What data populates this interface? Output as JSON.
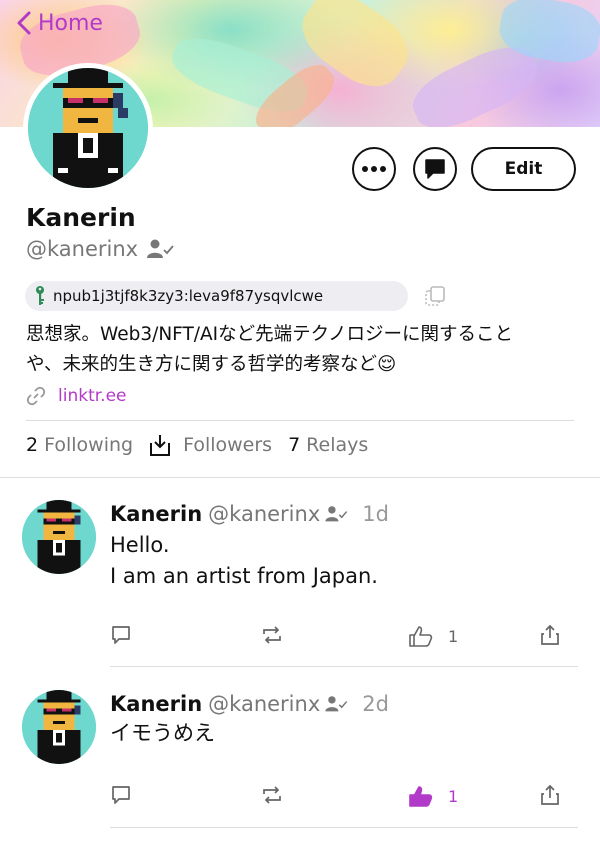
{
  "nav": {
    "back_label": "Home"
  },
  "profile": {
    "name": "Kanerin",
    "handle": "@kanerinx",
    "npub": "npub1j3tjf8k3zy3:leva9f87ysqvlcwe",
    "bio_line1": "思想家。Web3/NFT/AIなど先端テクノロジーに関すること",
    "bio_line2": "や、未来的生き方に関する哲学的考察など😌",
    "link": "linktr.ee",
    "edit_label": "Edit"
  },
  "stats": {
    "following_count": "2",
    "following_label": "Following",
    "followers_label": "Followers",
    "relays_count": "7",
    "relays_label": "Relays"
  },
  "posts": [
    {
      "author": "Kanerin",
      "handle": "@kanerinx",
      "time": "1d",
      "lines": [
        "Hello.",
        "I am an artist from Japan."
      ],
      "likes": "1",
      "liked": false
    },
    {
      "author": "Kanerin",
      "handle": "@kanerinx",
      "time": "2d",
      "lines": [
        "イモうめえ"
      ],
      "likes": "1",
      "liked": true
    }
  ],
  "colors": {
    "accent": "#b23ac8",
    "avatar_bg": "#6ed8cf",
    "muted": "#777777"
  },
  "icons": [
    "chevron-left-icon",
    "more-icon",
    "message-icon",
    "key-icon",
    "copy-icon",
    "link-icon",
    "download-icon",
    "reply-icon",
    "repost-icon",
    "like-icon",
    "share-icon",
    "verified-user-icon"
  ]
}
